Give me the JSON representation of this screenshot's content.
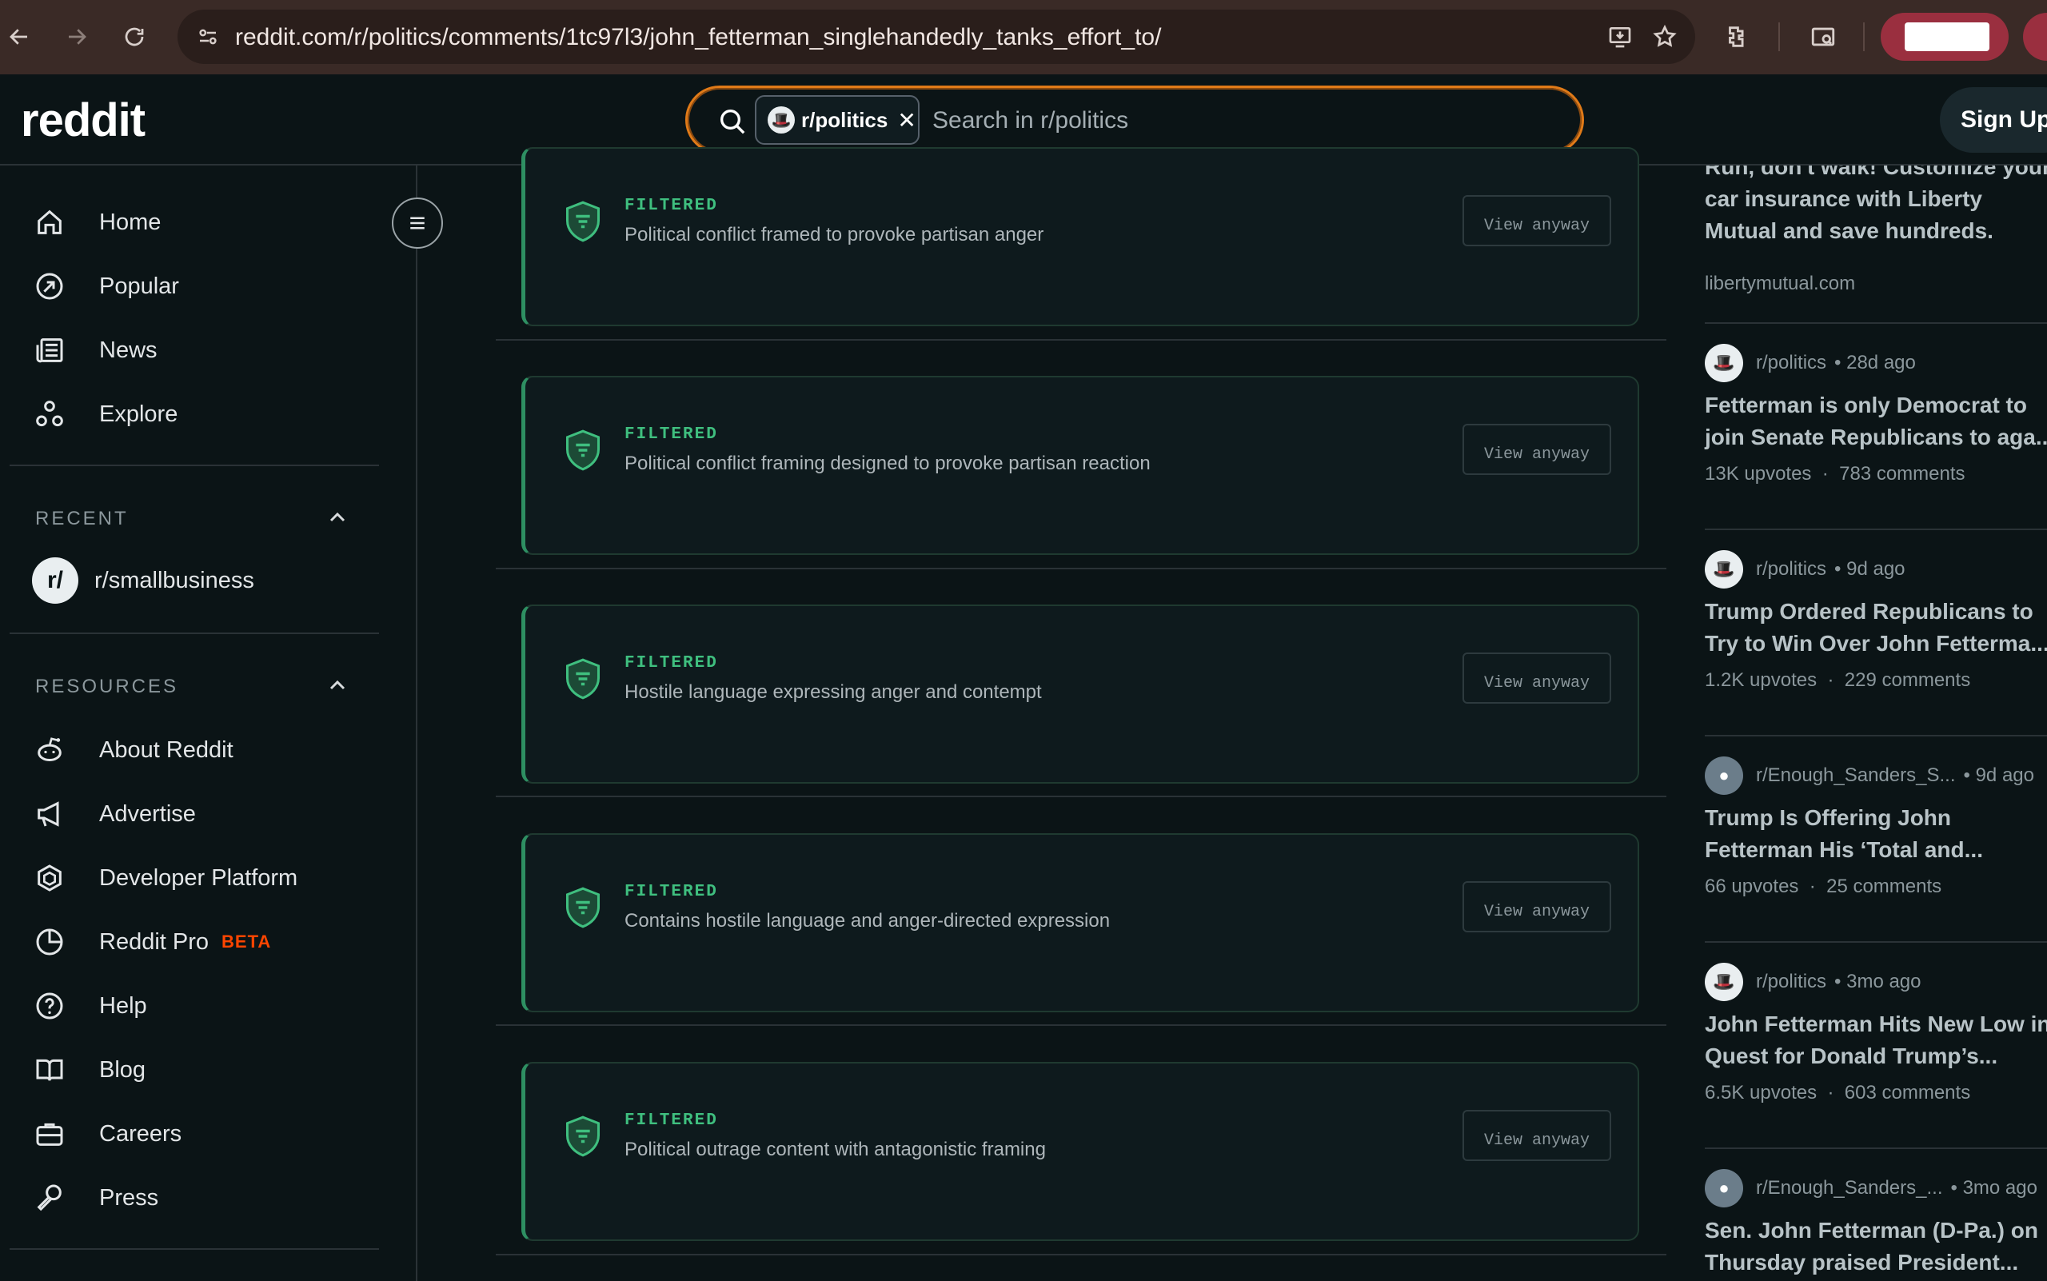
{
  "browser": {
    "url": "reddit.com/r/politics/comments/1tc97l3/john_fetterman_singlehandedly_tanks_effort_to/"
  },
  "header": {
    "logo": "reddit",
    "search_chip": "r/politics",
    "search_placeholder": "Search in r/politics",
    "signup_label": "Sign Up"
  },
  "sidebar": {
    "nav": [
      {
        "label": "Home",
        "icon": "home-icon"
      },
      {
        "label": "Popular",
        "icon": "popular-icon"
      },
      {
        "label": "News",
        "icon": "news-icon"
      },
      {
        "label": "Explore",
        "icon": "explore-icon"
      }
    ],
    "recent_title": "RECENT",
    "recent": [
      {
        "label": "r/smallbusiness",
        "avatar": "r/"
      }
    ],
    "resources_title": "RESOURCES",
    "resources": [
      {
        "label": "About Reddit",
        "icon": "reddit-alien-icon"
      },
      {
        "label": "Advertise",
        "icon": "megaphone-icon"
      },
      {
        "label": "Developer Platform",
        "icon": "hexagon-icon"
      },
      {
        "label": "Reddit Pro",
        "icon": "pie-chart-icon",
        "badge": "BETA"
      },
      {
        "label": "Help",
        "icon": "help-icon"
      },
      {
        "label": "Blog",
        "icon": "book-icon"
      },
      {
        "label": "Careers",
        "icon": "briefcase-icon"
      },
      {
        "label": "Press",
        "icon": "microphone-icon"
      }
    ]
  },
  "main": {
    "cards": [
      {
        "tag": "FILTERED",
        "reason": "Political conflict framed to provoke partisan anger",
        "button": "View anyway"
      },
      {
        "tag": "FILTERED",
        "reason": "Political conflict framing designed to provoke partisan reaction",
        "button": "View anyway"
      },
      {
        "tag": "FILTERED",
        "reason": "Hostile language expressing anger and contempt",
        "button": "View anyway"
      },
      {
        "tag": "FILTERED",
        "reason": "Contains hostile language and anger-directed expression",
        "button": "View anyway"
      },
      {
        "tag": "FILTERED",
        "reason": "Political outrage content with antagonistic framing",
        "button": "View anyway"
      }
    ]
  },
  "right": {
    "ad_text": "Run, don't walk! Customize your car insurance with Liberty Mutual and save hundreds.",
    "ad_domain": "libertymutual.com",
    "posts": [
      {
        "sub": "r/politics",
        "time": "• 28d ago",
        "title1": "Fetterman is only Democrat to",
        "title2": "join Senate Republicans to aga...",
        "upvotes": "13K upvotes",
        "comments": "783 comments"
      },
      {
        "sub": "r/politics",
        "time": "• 9d ago",
        "title1": "Trump Ordered Republicans to",
        "title2": "Try to Win Over John Fetterma...",
        "upvotes": "1.2K upvotes",
        "comments": "229 comments"
      },
      {
        "sub": "r/Enough_Sanders_S...",
        "time": "• 9d ago",
        "title1": "Trump Is Offering John",
        "title2": "Fetterman His ‘Total and...",
        "upvotes": "66 upvotes",
        "comments": "25 comments"
      },
      {
        "sub": "r/politics",
        "time": "• 3mo ago",
        "title1": "John Fetterman Hits New Low in",
        "title2": "Quest for Donald Trump’s...",
        "upvotes": "6.5K upvotes",
        "comments": "603 comments"
      },
      {
        "sub": "r/Enough_Sanders_...",
        "time": "• 3mo ago",
        "title1": "Sen. John Fetterman (D-Pa.) on",
        "title2": "Thursday praised President...",
        "upvotes": "",
        "comments": ""
      }
    ]
  }
}
